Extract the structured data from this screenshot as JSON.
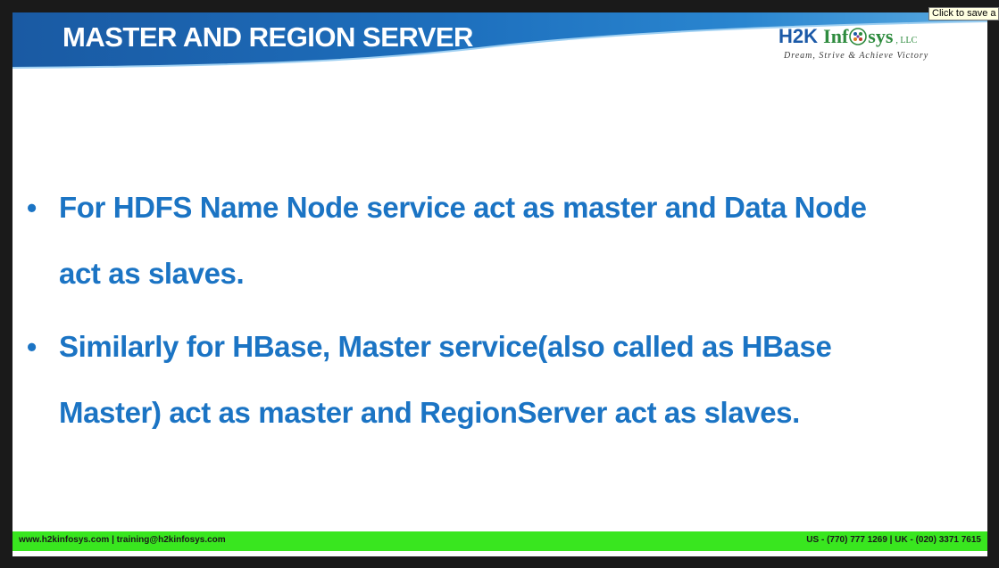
{
  "slide": {
    "title": "MASTER AND REGION SERVER",
    "bullets": [
      {
        "lines": [
          "For HDFS Name Node service act as master and Data Node",
          "act as slaves."
        ]
      },
      {
        "lines": [
          "Similarly for HBase, Master service(also called as HBase",
          "Master) act as master and RegionServer act as slaves."
        ]
      }
    ]
  },
  "logo": {
    "h2k": "H2K",
    "info": "Inf",
    "sys": "sys",
    "llc": ", LLC",
    "tagline": "Dream, Strive & Achieve Victory",
    "icon": "globe-icon"
  },
  "footer": {
    "left": "www.h2kinfosys.com  |  training@h2kinfosys.com",
    "right": "US - (770) 777 1269  |  UK - (020) 3371 7615"
  },
  "tooltip": {
    "text": "Click to save a p"
  },
  "colors": {
    "header_blue": "#1b5fa8",
    "bullet_blue": "#1b74c4",
    "footer_green": "#39e61f",
    "logo_blue": "#1c5aa8",
    "logo_green": "#2e8b3e"
  }
}
